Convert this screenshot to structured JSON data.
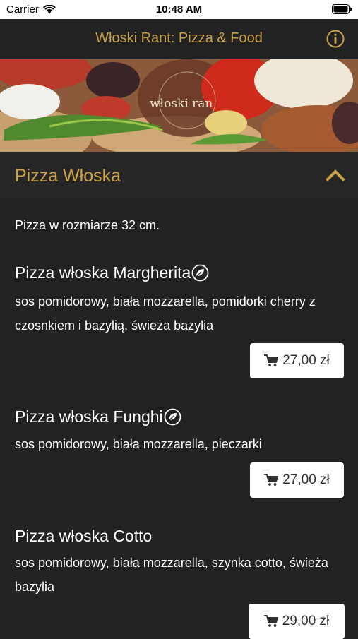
{
  "status": {
    "carrier": "Carrier",
    "time": "10:48 AM"
  },
  "nav": {
    "title": "Włoski Rant: Pizza & Food"
  },
  "hero": {
    "logo_text": "włoski ran"
  },
  "section": {
    "title": "Pizza Włoska",
    "note": "Pizza w rozmiarze 32 cm."
  },
  "items": [
    {
      "name": "Pizza włoska Margherita",
      "desc": " sos pomidorowy, biała mozzarella, pomidorki cherry z czosnkiem i bazylią, świeża bazylia",
      "price": "27,00 zł",
      "vegetarian": true
    },
    {
      "name": "Pizza włoska Funghi",
      "desc": " sos pomidorowy, biała mozzarella, pieczarki",
      "price": "27,00 zł",
      "vegetarian": true
    },
    {
      "name": "Pizza włoska Cotto",
      "desc": " sos pomidorowy, biała mozzarella, szynka cotto, świeża bazylia",
      "price": "29,00 zł",
      "vegetarian": false
    }
  ],
  "colors": {
    "accent": "#c9a24a",
    "background": "#222222"
  }
}
